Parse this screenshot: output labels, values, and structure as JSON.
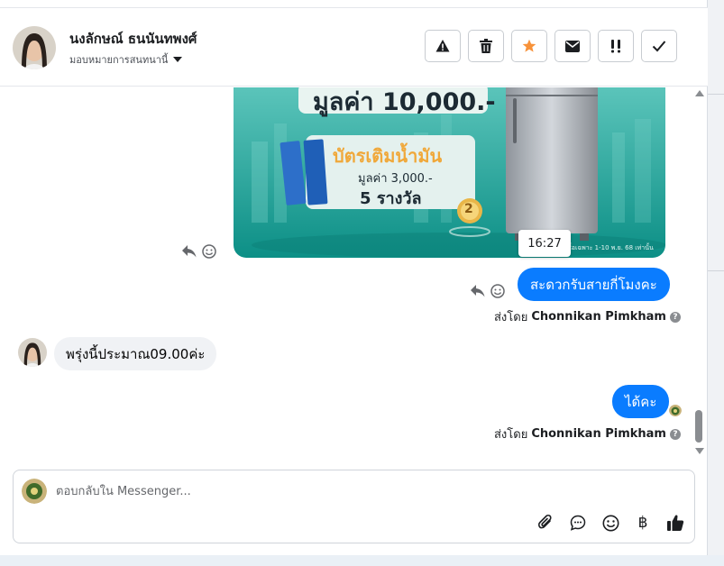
{
  "header": {
    "contact_name": "นงลักษณ์ ธนนันทพงศ์",
    "assign_label": "มอบหมายการสนทนานี้"
  },
  "promo": {
    "value_text": "มูลค่า 10,000.-",
    "fuel_title": "บัตรเติมน้ำมัน",
    "fuel_value": "มูลค่า 3,000.-",
    "prize_count": "5 รางวัล",
    "badge_number": "2",
    "fine_print": "ซื้อเฉพาะ 1-10 พ.ย. 68 เท่านั้น"
  },
  "tooltip": {
    "time": "16:27"
  },
  "messages": [
    {
      "direction": "out",
      "text": "สะดวกรับสายกี่โมงคะ"
    },
    {
      "direction": "in",
      "text": "พรุ่งนี้ประมาณ09.00ค่ะ"
    },
    {
      "direction": "out",
      "text": "ได้คะ"
    }
  ],
  "sent_by": {
    "prefix": "ส่งโดย",
    "name": "Chonnikan Pimkham"
  },
  "composer": {
    "placeholder": "ตอบกลับใน Messenger...",
    "currency_symbol": "฿"
  },
  "colors": {
    "accent": "#0a7cff",
    "star": "#f7923a",
    "promo_teal": "#1aa39a"
  }
}
